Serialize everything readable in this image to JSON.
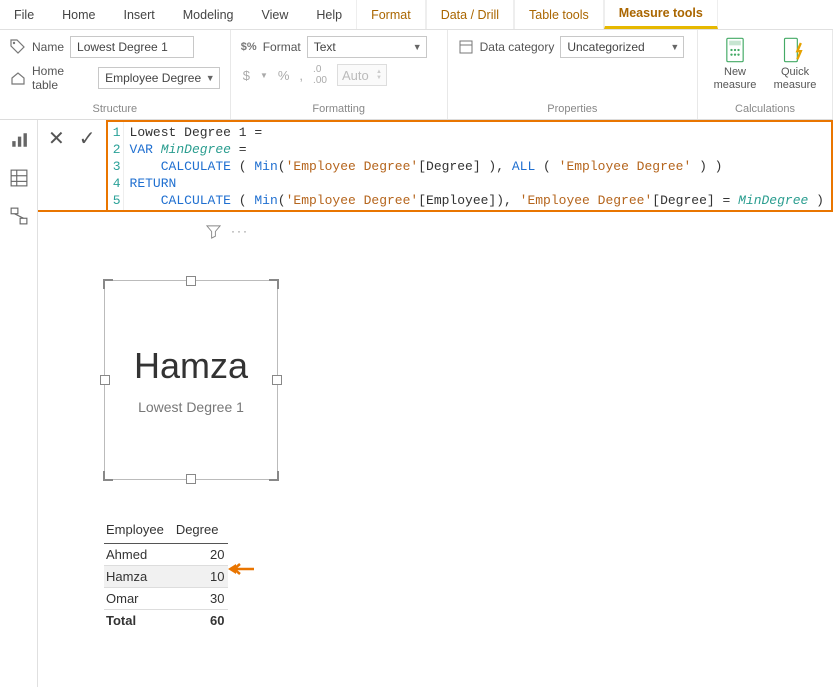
{
  "menu": {
    "items": [
      "File",
      "Home",
      "Insert",
      "Modeling",
      "View",
      "Help",
      "Format",
      "Data / Drill",
      "Table tools",
      "Measure tools"
    ],
    "context_start_index": 6,
    "active_index": 9
  },
  "ribbon": {
    "structure": {
      "label": "Structure",
      "name_label": "Name",
      "name_value": "Lowest Degree 1",
      "table_label": "Home table",
      "table_value": "Employee Degree"
    },
    "formatting": {
      "label": "Formatting",
      "format_label": "Format",
      "format_value": "Text",
      "auto_label": "Auto",
      "sym_currency": "$",
      "sym_percent": "%",
      "sym_comma": ",",
      "sym_decimals": ".00"
    },
    "properties": {
      "label": "Properties",
      "category_label": "Data category",
      "category_value": "Uncategorized"
    },
    "calculations": {
      "label": "Calculations",
      "new_measure": "New measure",
      "quick_measure": "Quick measure"
    }
  },
  "formula": {
    "cancel": "✕",
    "commit": "✓",
    "lines": [
      {
        "n": "1",
        "tokens": [
          {
            "t": "plain",
            "v": "Lowest Degree 1 = "
          }
        ]
      },
      {
        "n": "2",
        "tokens": [
          {
            "t": "kw-blue",
            "v": "VAR"
          },
          {
            "t": "plain",
            "v": " "
          },
          {
            "t": "ident",
            "v": "MinDegree"
          },
          {
            "t": "plain",
            "v": " ="
          }
        ]
      },
      {
        "n": "3",
        "tokens": [
          {
            "t": "plain",
            "v": "    "
          },
          {
            "t": "kw-func",
            "v": "CALCULATE"
          },
          {
            "t": "plain",
            "v": " ( "
          },
          {
            "t": "kw-func",
            "v": "Min"
          },
          {
            "t": "plain",
            "v": "("
          },
          {
            "t": "str",
            "v": "'Employee Degree'"
          },
          {
            "t": "plain",
            "v": "[Degree] ), "
          },
          {
            "t": "kw-func",
            "v": "ALL"
          },
          {
            "t": "plain",
            "v": " ( "
          },
          {
            "t": "str",
            "v": "'Employee Degree'"
          },
          {
            "t": "plain",
            "v": " ) )"
          }
        ]
      },
      {
        "n": "4",
        "tokens": [
          {
            "t": "kw-blue",
            "v": "RETURN"
          }
        ]
      },
      {
        "n": "5",
        "tokens": [
          {
            "t": "plain",
            "v": "    "
          },
          {
            "t": "kw-func",
            "v": "CALCULATE"
          },
          {
            "t": "plain",
            "v": " ( "
          },
          {
            "t": "kw-func",
            "v": "Min"
          },
          {
            "t": "plain",
            "v": "("
          },
          {
            "t": "str",
            "v": "'Employee Degree'"
          },
          {
            "t": "plain",
            "v": "[Employee]), "
          },
          {
            "t": "str",
            "v": "'Employee Degree'"
          },
          {
            "t": "plain",
            "v": "[Degree] = "
          },
          {
            "t": "ident",
            "v": "MinDegree"
          },
          {
            "t": "plain",
            "v": " )"
          }
        ]
      }
    ]
  },
  "card": {
    "value": "Hamza",
    "label": "Lowest Degree 1"
  },
  "table": {
    "columns": [
      "Employee",
      "Degree"
    ],
    "rows": [
      {
        "employee": "Ahmed",
        "degree": "20",
        "hl": false
      },
      {
        "employee": "Hamza",
        "degree": "10",
        "hl": true
      },
      {
        "employee": "Omar",
        "degree": "30",
        "hl": false
      }
    ],
    "total_label": "Total",
    "total_value": "60"
  },
  "icons": {
    "filter": "filter-icon",
    "more": "more-icon"
  }
}
